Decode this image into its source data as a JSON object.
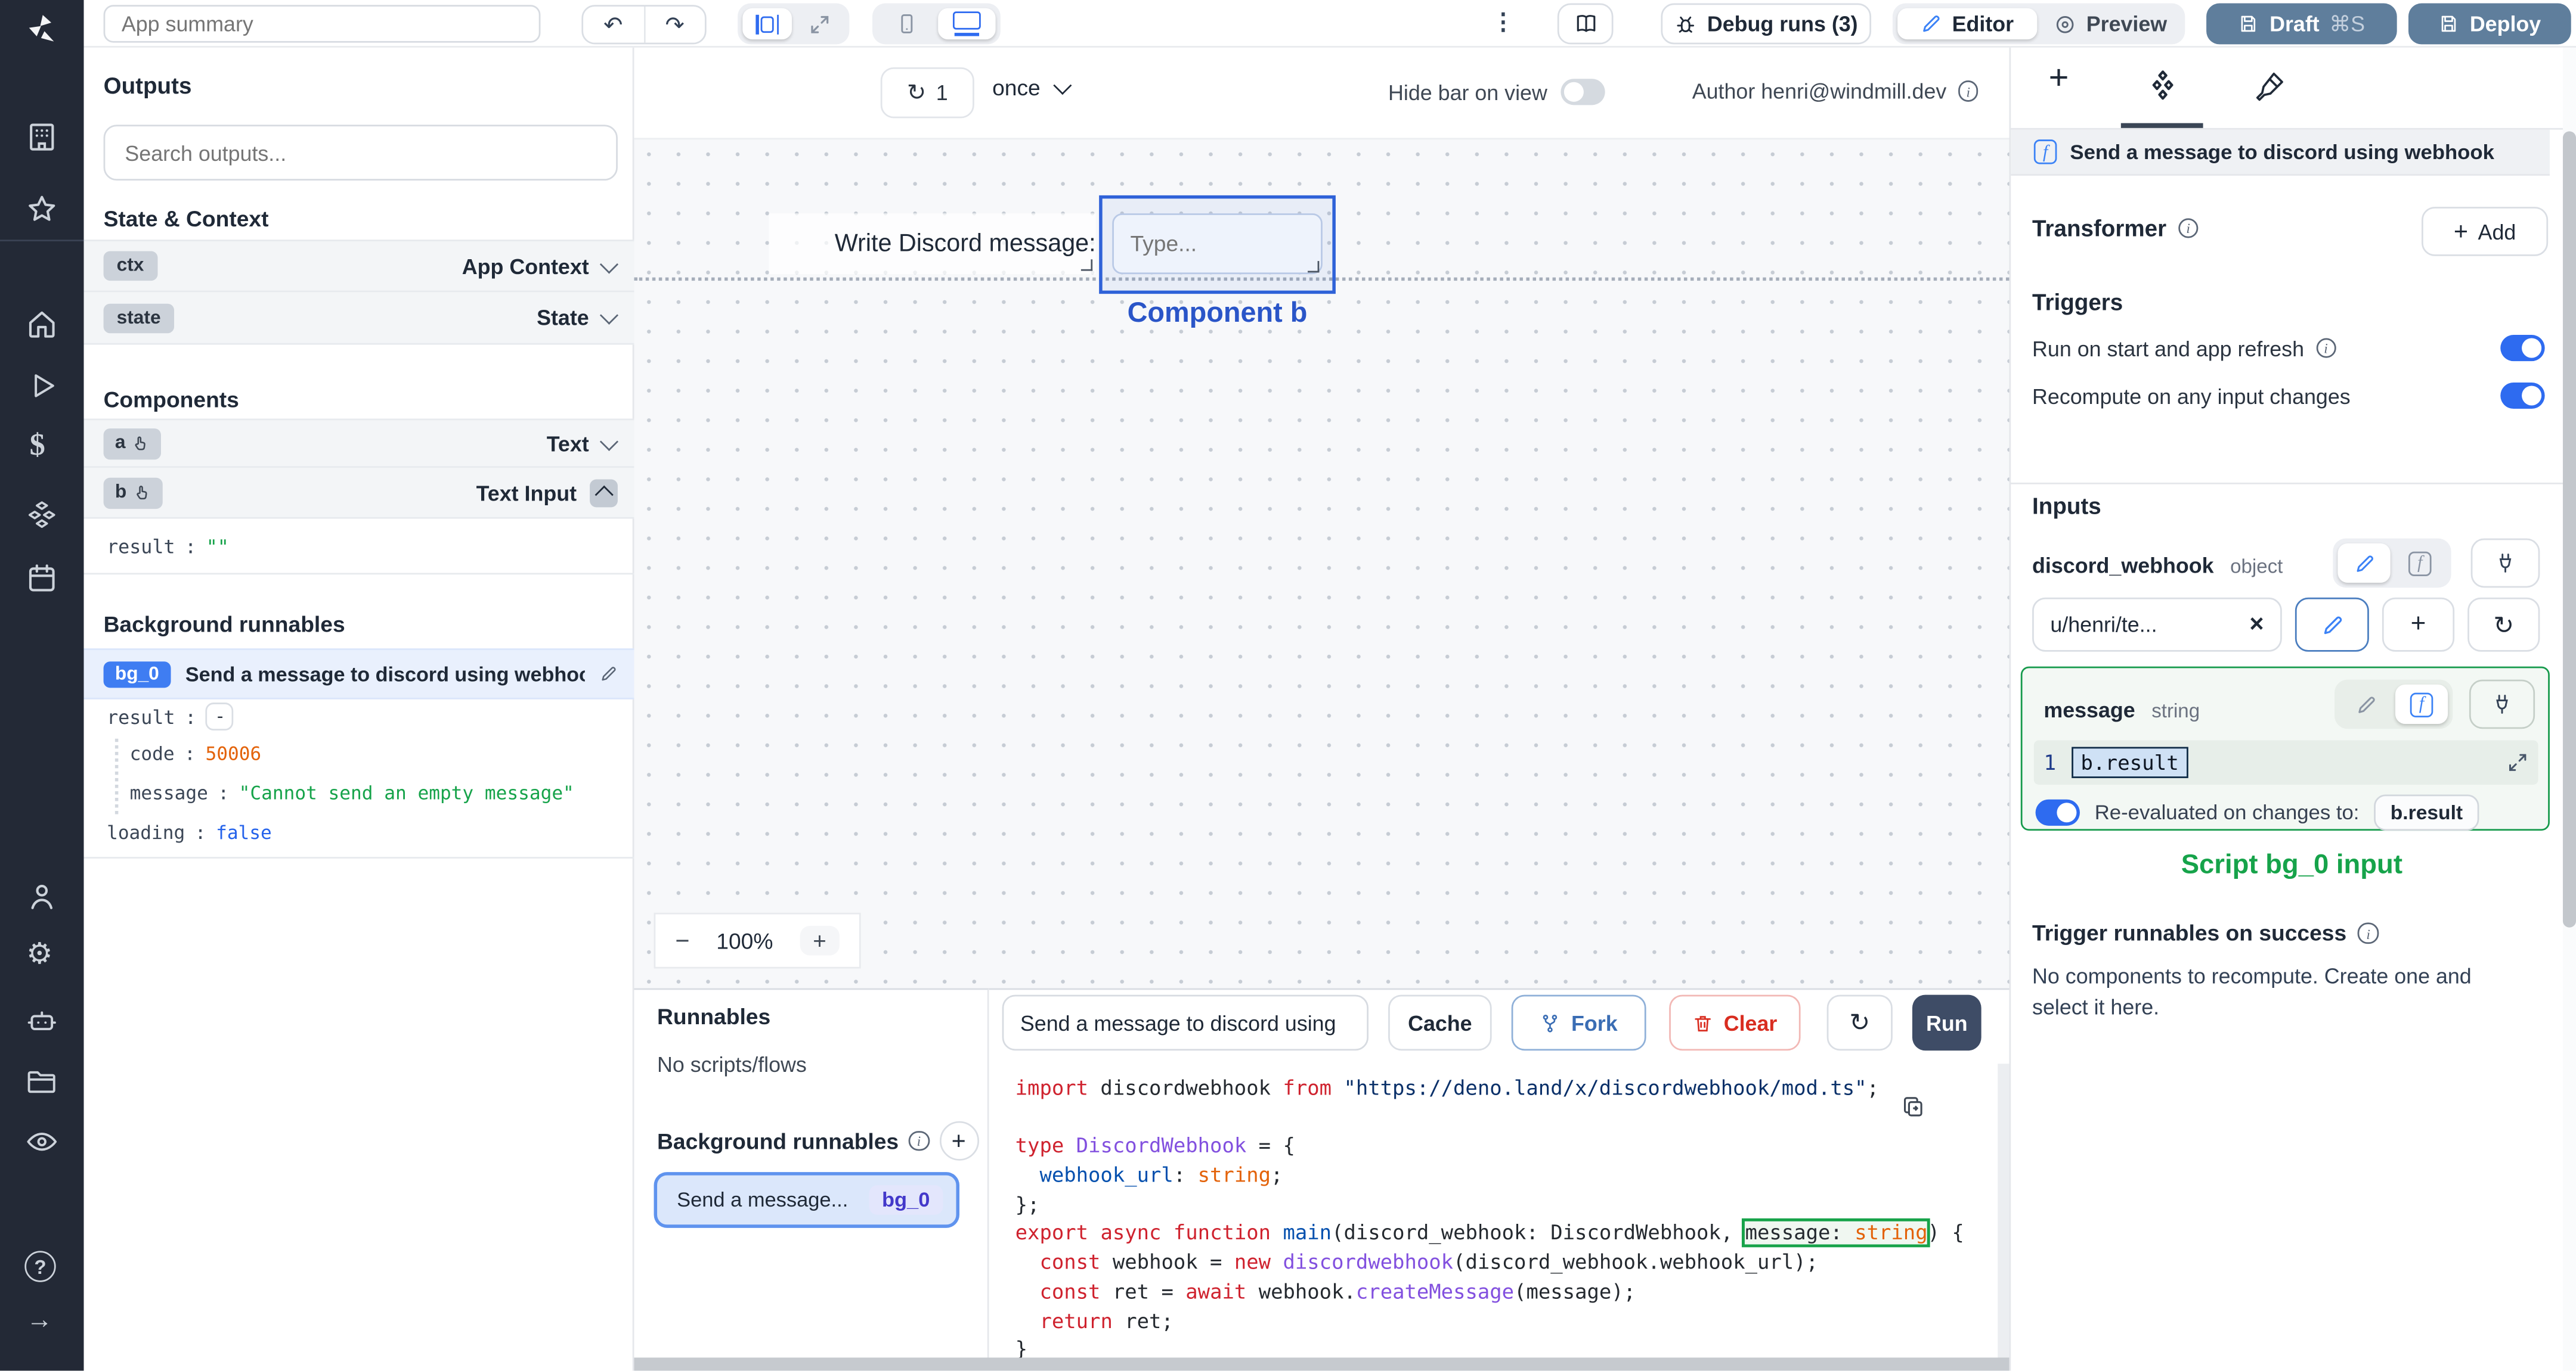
{
  "colors": {
    "accent_blue": "#2e6bf0",
    "selection_blue": "#2f62d8",
    "draft_slate": "#5f7e9c",
    "run_navy": "#3e4c66",
    "success_green": "#16a34a",
    "error_red": "#d92d20",
    "code_orange": "#e36209",
    "badge_indigo": "#4338ca",
    "bg0_badge_blue": "#3f7df2"
  },
  "topbar": {
    "app_summary_placeholder": "App summary",
    "undo": "↶",
    "redo": "↷",
    "menu": "⋮",
    "debug_runs_label": "Debug runs (3)",
    "editor_label": "Editor",
    "preview_label": "Preview",
    "draft_label": "Draft",
    "draft_shortcut": "⌘S",
    "deploy_label": "Deploy"
  },
  "left": {
    "outputs_title": "Outputs",
    "search_placeholder": "Search outputs...",
    "state_context_title": "State & Context",
    "ctx_badge": "ctx",
    "ctx_type": "App Context",
    "state_badge": "state",
    "state_type": "State",
    "components_title": "Components",
    "a_badge": "a",
    "a_type": "Text",
    "b_badge": "b",
    "b_type": "Text Input",
    "b_result_key": "result",
    "b_result_colon": ":",
    "b_result_value": "\"\"",
    "background_title": "Background runnables",
    "bg0_badge": "bg_0",
    "bg0_title": "Send a message to discord using webhook",
    "result_key": "result",
    "result_colon": ":",
    "collapse_label": "-",
    "code_key": "code",
    "code_colon": ":",
    "code_value": "50006",
    "message_key": "message",
    "message_colon": ":",
    "message_value": "\"Cannot send an empty message\"",
    "loading_key": "loading",
    "loading_colon": ":",
    "loading_value": "false"
  },
  "canvas": {
    "refresh_icon": "↻",
    "refresh_count": "1",
    "schedule_mode": "once",
    "hide_bar_label": "Hide bar on view",
    "author_label": "Author henri@windmill.dev",
    "text_a": "Write Discord message:",
    "input_placeholder": "Type...",
    "selected_component_label": "Component b",
    "zoom_out": "−",
    "zoom_level": "100%",
    "zoom_in": "+"
  },
  "runnables": {
    "title": "Runnables",
    "empty_label": "No scripts/flows",
    "background_title": "Background runnables",
    "add": "+",
    "item_title": "Send a message...",
    "item_badge": "bg_0"
  },
  "editor": {
    "script_name": "Send a message to discord using",
    "cache_label": "Cache",
    "fork_label": "Fork",
    "clear_label": "Clear",
    "refresh_icon": "↻",
    "run_label": "Run",
    "code_lines": [
      {
        "seg": [
          [
            "import",
            "k"
          ],
          [
            " discordwebhook ",
            "d"
          ],
          [
            "from",
            "k"
          ],
          [
            " ",
            "d"
          ],
          [
            "\"https://deno.land/x/discordwebhook/mod.ts\"",
            "s"
          ],
          [
            ";",
            "d"
          ]
        ]
      },
      {
        "seg": []
      },
      {
        "seg": [
          [
            "type",
            "k"
          ],
          [
            " ",
            "d"
          ],
          [
            "DiscordWebhook",
            "t"
          ],
          [
            " = {",
            "d"
          ]
        ]
      },
      {
        "seg": [
          [
            "  webhook_url",
            "b"
          ],
          [
            ": ",
            "d"
          ],
          [
            "string",
            "o"
          ],
          [
            ";",
            "d"
          ]
        ]
      },
      {
        "seg": [
          [
            "};",
            "d"
          ]
        ]
      },
      {
        "seg": [
          [
            "export",
            "k"
          ],
          [
            " ",
            "d"
          ],
          [
            "async",
            "k"
          ],
          [
            " ",
            "d"
          ],
          [
            "function",
            "k"
          ],
          [
            " ",
            "d"
          ],
          [
            "main",
            "b"
          ],
          [
            "(discord_webhook: DiscordWebhook, ",
            "d"
          ],
          [
            "message: ",
            "dh"
          ],
          [
            "string",
            "oh"
          ],
          [
            ") {",
            "d"
          ]
        ]
      },
      {
        "seg": [
          [
            "  ",
            "d"
          ],
          [
            "const",
            "k"
          ],
          [
            " webhook = ",
            "d"
          ],
          [
            "new",
            "k"
          ],
          [
            " ",
            "d"
          ],
          [
            "discordwebhook",
            "t"
          ],
          [
            "(discord_webhook.webhook_url);",
            "d"
          ]
        ]
      },
      {
        "seg": [
          [
            "  ",
            "d"
          ],
          [
            "const",
            "k"
          ],
          [
            " ret = ",
            "d"
          ],
          [
            "await",
            "k"
          ],
          [
            " webhook.",
            "d"
          ],
          [
            "createMessage",
            "t"
          ],
          [
            "(message);",
            "d"
          ]
        ]
      },
      {
        "seg": [
          [
            "  ",
            "d"
          ],
          [
            "return",
            "k"
          ],
          [
            " ret;",
            "d"
          ]
        ]
      },
      {
        "seg": [
          [
            "}",
            "d"
          ]
        ]
      }
    ]
  },
  "right": {
    "header_title": "Send a message to discord using webhook",
    "transformer_title": "Transformer",
    "add_label": "Add",
    "add_plus": "+",
    "triggers_title": "Triggers",
    "run_on_start_label": "Run on start and app refresh",
    "recompute_label": "Recompute on any input changes",
    "inputs_title": "Inputs",
    "dw_name": "discord_webhook",
    "dw_type": "object",
    "dw_value": "u/henri/te...",
    "dw_clear": "×",
    "plus": "+",
    "refresh_icon": "↻",
    "msg_name": "message",
    "msg_type": "string",
    "msg_line_number": "1",
    "msg_expr": "b.result",
    "reeval_label": "Re-evaluated on changes to:",
    "reeval_target": "b.result",
    "script_input_label": "Script bg_0 input",
    "trigger_success_title": "Trigger runnables on success",
    "no_components_text": "No components to recompute. Create one and select it here."
  }
}
